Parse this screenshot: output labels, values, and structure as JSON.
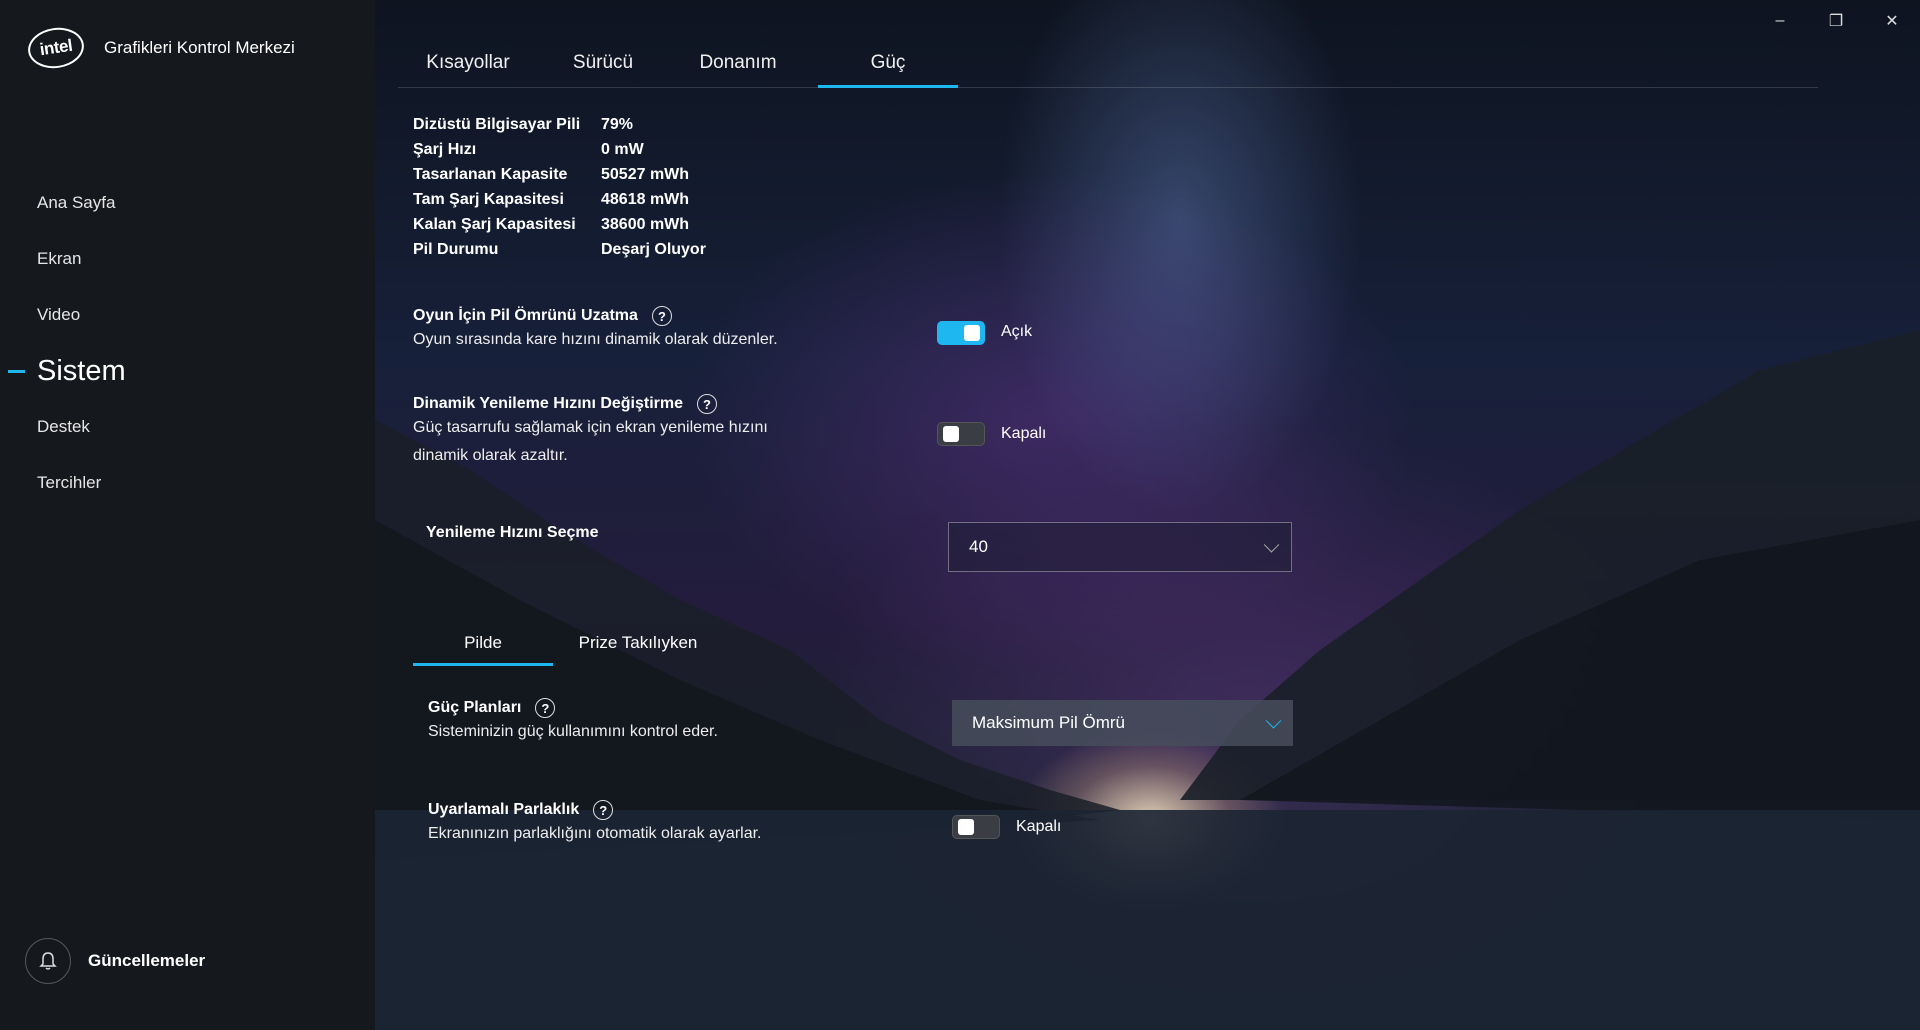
{
  "app": {
    "title": "Grafikleri Kontrol Merkezi",
    "logo_text": "intel"
  },
  "window_controls": {
    "minimize": "–",
    "restore": "❐",
    "close": "✕"
  },
  "sidebar": {
    "items": [
      {
        "label": "Ana Sayfa"
      },
      {
        "label": "Ekran"
      },
      {
        "label": "Video"
      },
      {
        "label": "Sistem"
      },
      {
        "label": "Destek"
      },
      {
        "label": "Tercihler"
      }
    ],
    "active": "Sistem",
    "updates_label": "Güncellemeler",
    "updates_icon": "bell-icon"
  },
  "tabs": [
    {
      "label": "Kısayollar"
    },
    {
      "label": "Sürücü"
    },
    {
      "label": "Donanım"
    },
    {
      "label": "Güç"
    }
  ],
  "active_tab": "Güç",
  "battery_info": [
    {
      "key": "Dizüstü Bilgisayar Pili",
      "value": "79%"
    },
    {
      "key": "Şarj Hızı",
      "value": "0 mW"
    },
    {
      "key": "Tasarlanan Kapasite",
      "value": "50527 mWh"
    },
    {
      "key": "Tam Şarj Kapasitesi",
      "value": "48618 mWh"
    },
    {
      "key": "Kalan Şarj Kapasitesi",
      "value": "38600 mWh"
    },
    {
      "key": "Pil Durumu",
      "value": "Deşarj Oluyor"
    }
  ],
  "settings": {
    "game_battery": {
      "title": "Oyun İçin Pil Ömrünü Uzatma",
      "desc": "Oyun sırasında kare hızını dinamik olarak düzenler.",
      "state_label": "Açık",
      "on": true
    },
    "dynamic_refresh": {
      "title": "Dinamik Yenileme Hızını Değiştirme",
      "desc_line1": "Güç tasarrufu sağlamak için ekran yenileme hızını",
      "desc_line2": "dinamik olarak azaltır.",
      "state_label": "Kapalı",
      "on": false
    },
    "refresh_select": {
      "title": "Yenileme Hızını Seçme",
      "value": "40"
    }
  },
  "subtabs": [
    {
      "label": "Pilde"
    },
    {
      "label": "Prize Takılıyken"
    }
  ],
  "active_subtab": "Pilde",
  "power": {
    "plans": {
      "title": "Güç Planları",
      "desc": "Sisteminizin güç kullanımını kontrol eder.",
      "value": "Maksimum Pil Ömrü"
    },
    "adaptive_brightness": {
      "title": "Uyarlamalı Parlaklık",
      "desc": "Ekranınızın parlaklığını otomatik olarak ayarlar.",
      "state_label": "Kapalı",
      "on": false
    }
  },
  "help_glyph": "?",
  "accent_color": "#1fb7f0"
}
